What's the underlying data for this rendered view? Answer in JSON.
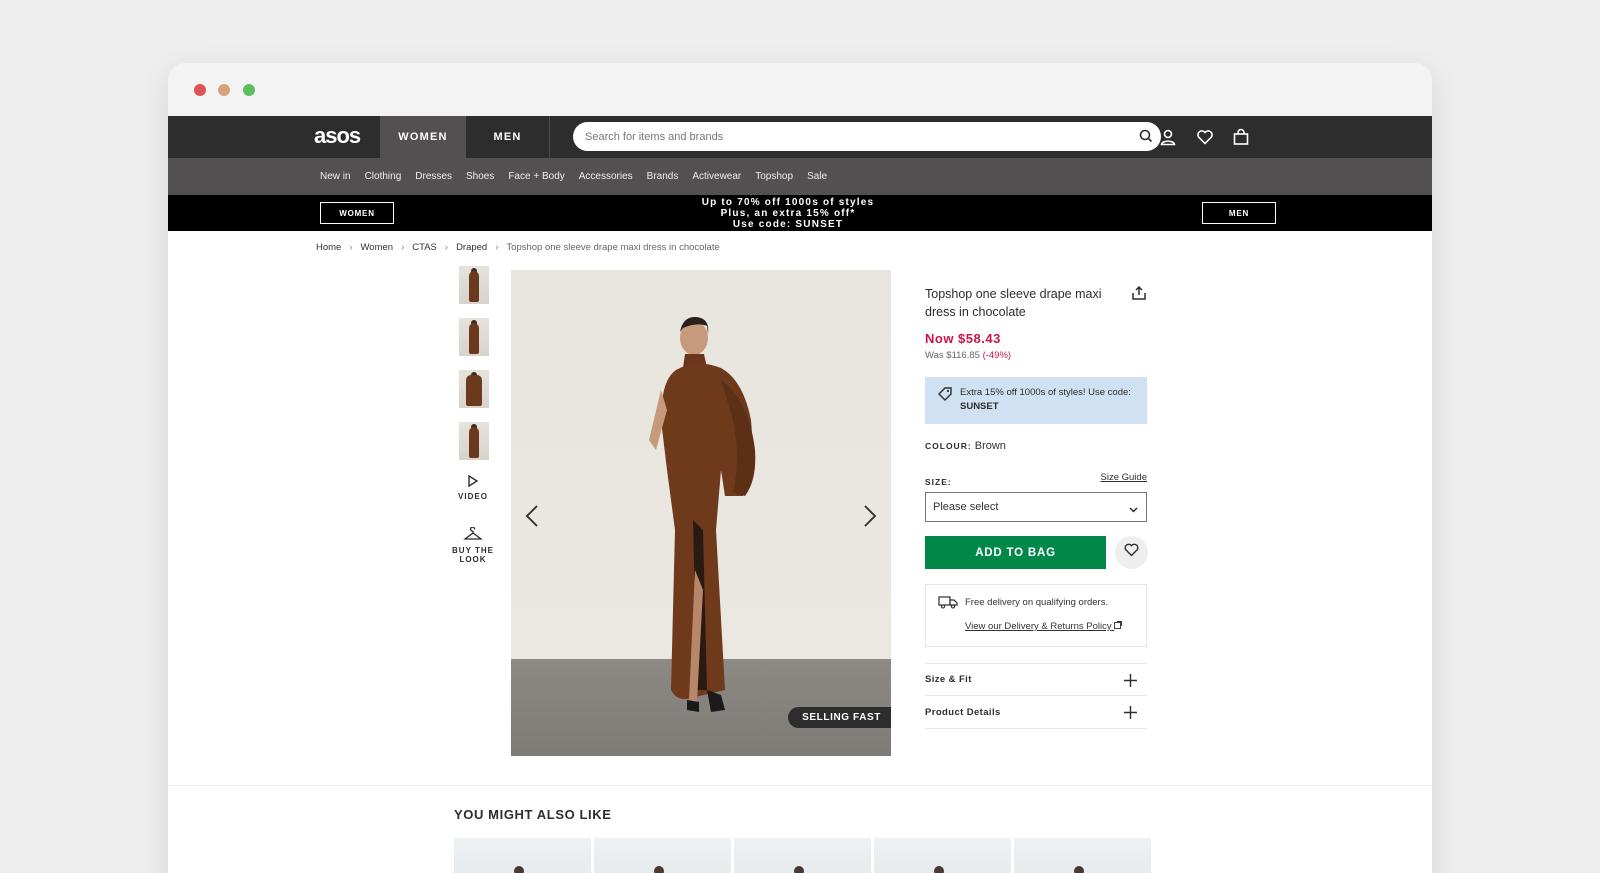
{
  "browser": {
    "traffic_lights": [
      "close",
      "minimize",
      "zoom"
    ]
  },
  "header": {
    "logo": "asos",
    "gender_tabs": [
      "WOMEN",
      "MEN"
    ],
    "search_placeholder": "Search for items and brands",
    "icons": [
      "search-icon",
      "account-icon",
      "saved-items-icon",
      "bag-icon"
    ]
  },
  "nav": {
    "items": [
      "New in",
      "Clothing",
      "Dresses",
      "Shoes",
      "Face + Body",
      "Accessories",
      "Brands",
      "Activewear",
      "Topshop",
      "Sale"
    ]
  },
  "promo": {
    "left_button": "WOMEN",
    "right_button": "MEN",
    "line1": "Up to 70% off 1000s of styles",
    "line2": "Plus, an extra 15% off*",
    "line3": "Use code: SUNSET"
  },
  "breadcrumb": [
    "Home",
    "Women",
    "CTAS",
    "Draped",
    "Topshop one sleeve drape maxi dress in chocolate"
  ],
  "gallery": {
    "video_label": "VIDEO",
    "buy_the_look_line1": "BUY THE",
    "buy_the_look_line2": "LOOK",
    "badge": "SELLING FAST"
  },
  "product": {
    "title": "Topshop one sleeve drape maxi dress in chocolate",
    "now_price": "Now $58.43",
    "was_label": "Was $116.85",
    "discount": "(-49%)",
    "promo_text": "Extra 15% off 1000s of styles! Use code:",
    "promo_code": "SUNSET",
    "colour_label": "COLOUR:",
    "colour_value": "Brown",
    "size_label": "SIZE:",
    "size_guide": "Size Guide",
    "size_placeholder": "Please select",
    "add_to_bag": "ADD TO BAG",
    "delivery_text": "Free delivery on qualifying orders.",
    "delivery_link": "View our Delivery & Returns Policy",
    "accordions": [
      "Size & Fit",
      "Product Details"
    ]
  },
  "recommendations": {
    "heading": "YOU MIGHT ALSO LIKE"
  },
  "colors": {
    "header_dark": "#2d2d2d",
    "nav_grey": "#525050",
    "price_red": "#d01345",
    "bag_green": "#018849",
    "promo_blue": "#cfe1f2"
  }
}
